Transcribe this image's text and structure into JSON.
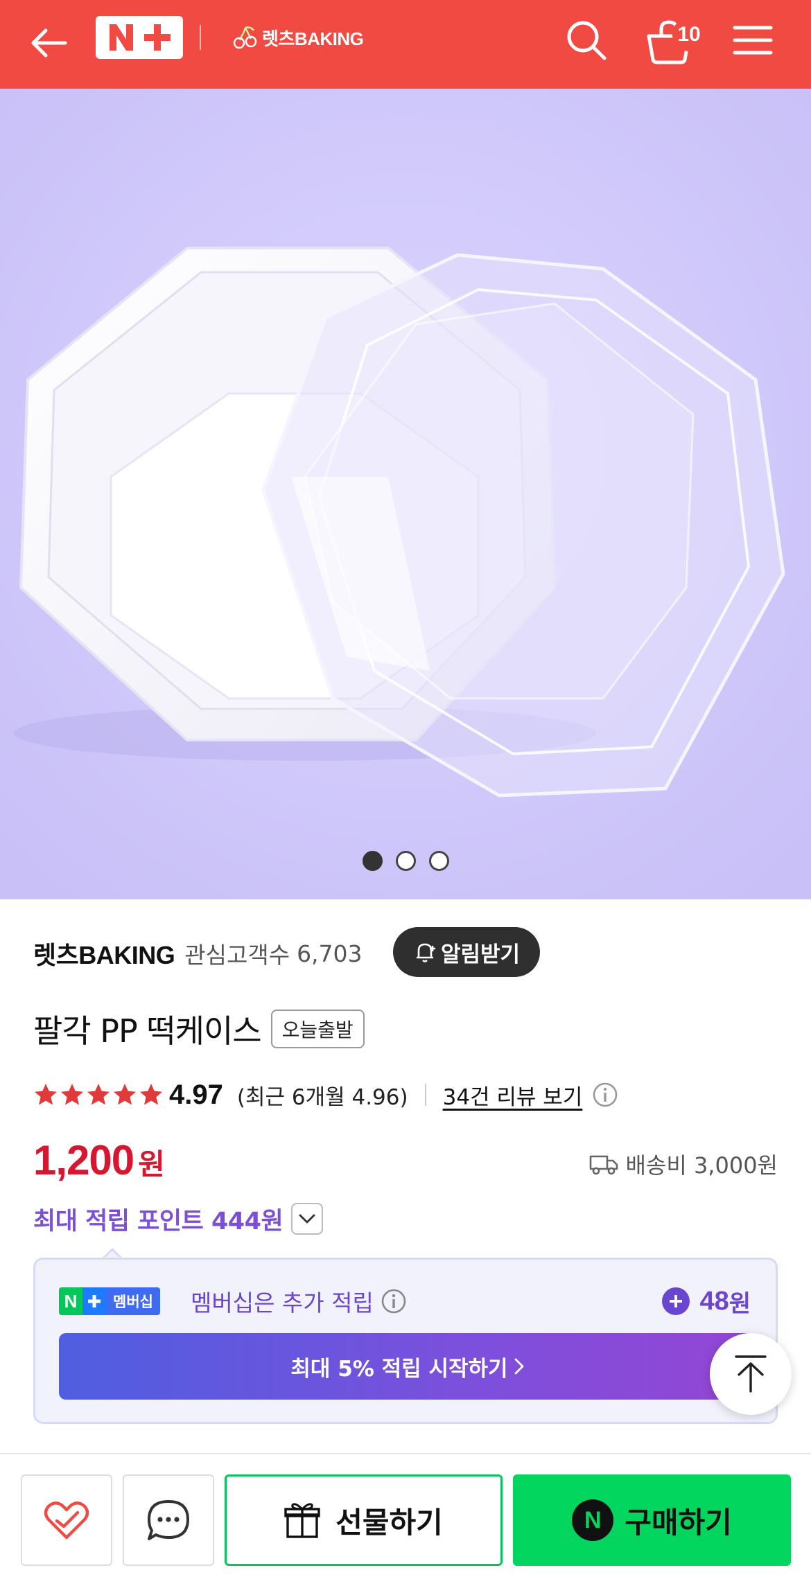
{
  "header": {
    "brand_mark": "N+",
    "store_logo_text": "렛츠BAKING",
    "cart_count": "10",
    "accent_color": "#f04a43"
  },
  "carousel": {
    "total": 3,
    "active_index": 0,
    "background_color": "#d3cdfb"
  },
  "store": {
    "name": "렛츠BAKING",
    "fans_label": "관심고객수",
    "fans_count": "6,703",
    "alarm_label": "알림받기"
  },
  "product": {
    "title": "팔각 PP 떡케이스",
    "badge": "오늘출발",
    "rating": "4.97",
    "rating_stars": 5,
    "recent_rating": "(최근 6개월 4.96)",
    "review_link": "34건 리뷰 보기",
    "price": "1,200",
    "currency": "원",
    "price_color": "#d6172f",
    "shipping": "배송비 3,000원",
    "points_label": "최대 적립 포인트 444원"
  },
  "membership": {
    "badge_n": "N",
    "badge_label": "멤버십",
    "text": "멤버십은 추가 적립",
    "bonus_amount": "48",
    "bonus_unit": "원",
    "cta": "최대 5% 적립 시작하기",
    "accent_color": "#6a45cf"
  },
  "bottom_bar": {
    "gift_label": "선물하기",
    "buy_label": "구매하기",
    "buy_n": "N",
    "buy_color": "#03d65e"
  }
}
